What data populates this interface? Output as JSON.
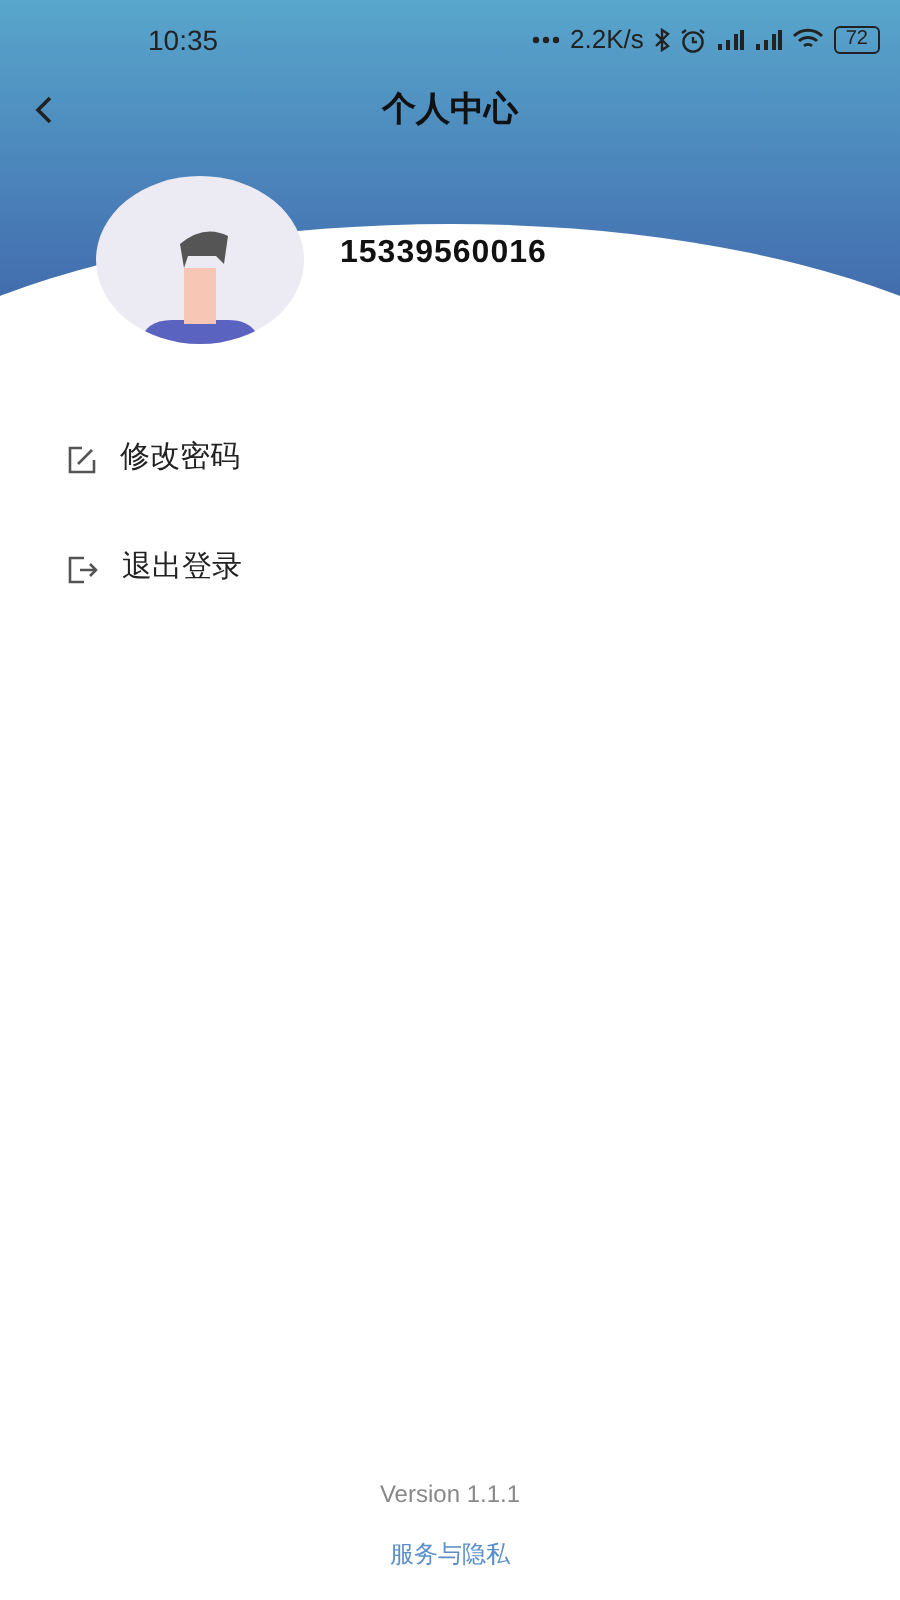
{
  "status_bar": {
    "time": "10:35",
    "speed": "2.2K/s",
    "battery": "72"
  },
  "nav": {
    "title": "个人中心"
  },
  "profile": {
    "phone": "15339560016"
  },
  "menu": [
    {
      "kind": "edit",
      "label": "修改密码"
    },
    {
      "kind": "logout",
      "label": "退出登录"
    }
  ],
  "footer": {
    "version": "Version 1.1.1",
    "link": "服务与隐私"
  }
}
